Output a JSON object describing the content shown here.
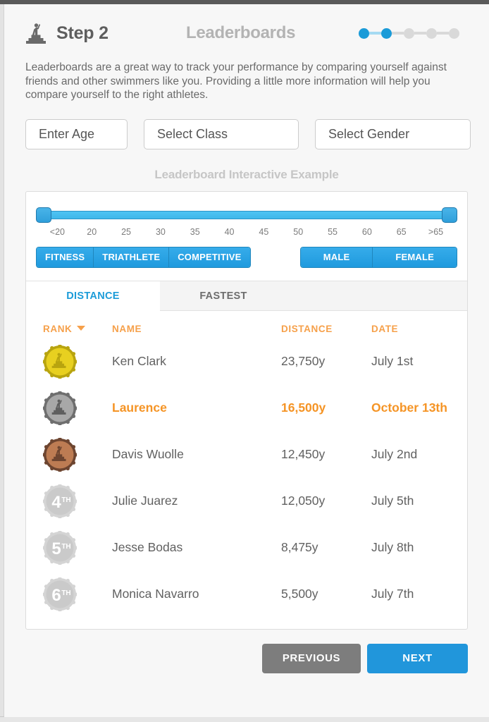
{
  "header": {
    "step_label": "Step 2",
    "section_title": "Leaderboards",
    "podium_icon": "podium-athlete-icon",
    "progress": {
      "total": 5,
      "completed": 2
    }
  },
  "description": "Leaderboards are a great way to track your performance by comparing yourself against friends and other swimmers like you. Providing a little more information will help you compare yourself to the right athletes.",
  "inputs": {
    "age_placeholder": "Enter Age",
    "age_value": "",
    "class_placeholder": "Select Class",
    "class_value": "",
    "gender_placeholder": "Select Gender",
    "gender_value": ""
  },
  "example": {
    "caption": "Leaderboard Interactive Example"
  },
  "slider": {
    "ticks": [
      "<20",
      "20",
      "25",
      "30",
      "35",
      "40",
      "45",
      "50",
      "55",
      "60",
      "65",
      ">65"
    ],
    "left_handle_value": "<20",
    "right_handle_value": ">65"
  },
  "filters": {
    "class_buttons": [
      {
        "label": "FITNESS",
        "active": true
      },
      {
        "label": "TRIATHLETE",
        "active": true
      },
      {
        "label": "COMPETITIVE",
        "active": true
      }
    ],
    "gender_buttons": [
      {
        "label": "MALE",
        "active": true
      },
      {
        "label": "FEMALE",
        "active": true
      }
    ]
  },
  "tabs": [
    {
      "label": "DISTANCE",
      "active": true
    },
    {
      "label": "FASTEST",
      "active": false
    }
  ],
  "table": {
    "columns": [
      "RANK",
      "NAME",
      "DISTANCE",
      "DATE"
    ],
    "sort_column": "RANK",
    "sort_direction": "desc",
    "rows": [
      {
        "rank": "1",
        "badge": "gold-medal-icon",
        "name": "Ken Clark",
        "distance": "23,750y",
        "date": "July 1st",
        "highlight": false
      },
      {
        "rank": "2",
        "badge": "silver-medal-icon",
        "name": "Laurence",
        "distance": "16,500y",
        "date": "October 13th",
        "highlight": true
      },
      {
        "rank": "3",
        "badge": "bronze-medal-icon",
        "name": "Davis Wuolle",
        "distance": "12,450y",
        "date": "July 2nd",
        "highlight": false
      },
      {
        "rank": "4",
        "badge": "rank-badge-4th",
        "rank_text": "4",
        "rank_suffix": "TH",
        "name": "Julie Juarez",
        "distance": "12,050y",
        "date": "July 5th",
        "highlight": false
      },
      {
        "rank": "5",
        "badge": "rank-badge-5th",
        "rank_text": "5",
        "rank_suffix": "TH",
        "name": "Jesse Bodas",
        "distance": "8,475y",
        "date": "July 8th",
        "highlight": false
      },
      {
        "rank": "6",
        "badge": "rank-badge-6th",
        "rank_text": "6",
        "rank_suffix": "TH",
        "name": "Monica Navarro",
        "distance": "5,500y",
        "date": "July 7th",
        "highlight": false
      }
    ]
  },
  "footer": {
    "previous_label": "PREVIOUS",
    "next_label": "NEXT"
  },
  "colors": {
    "accent_blue": "#1b9bd8",
    "accent_orange": "#f59425",
    "header_orange": "#f6a04a",
    "text_gray": "#616161",
    "muted_gray": "#b3b3b3",
    "gold": "#e8d020",
    "silver": "#9a9a9a",
    "bronze": "#b5724a",
    "previous_gray": "#7d7d7d"
  }
}
